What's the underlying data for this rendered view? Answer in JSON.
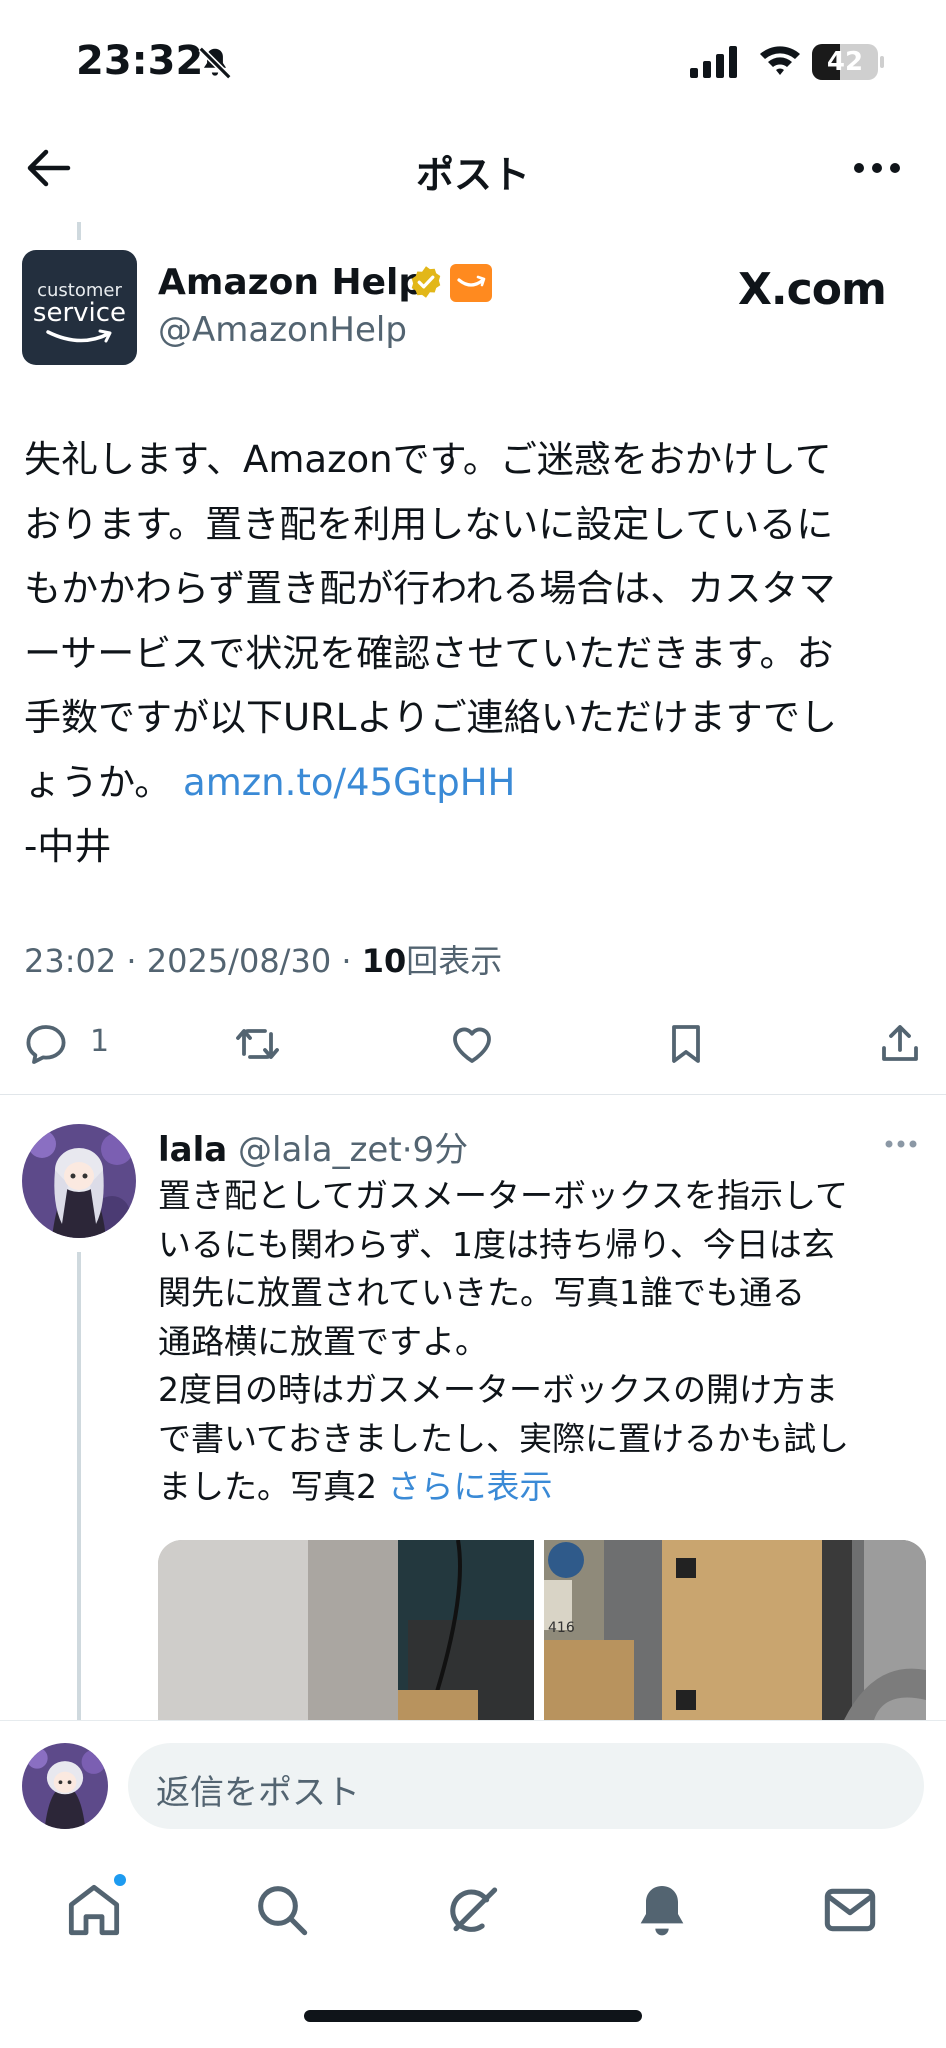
{
  "status_bar": {
    "time": "23:32",
    "battery_level": "42",
    "battery_fraction": 0.42,
    "icons": [
      "bell-slash-icon",
      "cellular-signal-icon",
      "wifi-icon",
      "battery-icon"
    ]
  },
  "header": {
    "title": "ポスト",
    "back_icon": "arrow-left-icon",
    "more_icon": "more-horizontal-icon"
  },
  "tweet": {
    "avatar": {
      "line1": "customer",
      "line2": "service"
    },
    "display_name": "Amazon Help",
    "handle": "@AmazonHelp",
    "watermark": "X.com",
    "body_lines": [
      "失礼します、Amazonです。ご迷惑をおかけして",
      "おります。置き配を利用しないに設定しているに",
      "もかかわらず置き配が行われる場合は、カスタマ",
      "ーサービスで状況を確認させていただきます。お",
      "手数ですが以下URLよりご連絡いただけますでし"
    ],
    "body_last_prefix": "ょうか。 ",
    "link": "amzn.to/45GtpHH",
    "signature": "-中井",
    "time": "23:02",
    "date": "2025/08/30",
    "views_count": "10",
    "views_label": "回表示",
    "reply_count": "1",
    "accent": "#3a8ad6"
  },
  "reply": {
    "name": "lala",
    "handle": "@lala_zet",
    "time": "9分",
    "lines": [
      "置き配としてガスメーターボックスを指示して",
      "いるにも関わらず、1度は持ち帰り、今日は玄",
      "関先に放置されていきた。写真1誰でも通る",
      "通路横に放置ですよ。",
      "2度目の時はガスメーターボックスの開け方ま",
      "で書いておきましたし、実際に置けるかも試し"
    ],
    "last_line_prefix": "ました。写真2 ",
    "show_more": "さらに表示",
    "photo2_label": "416"
  },
  "compose": {
    "placeholder": "返信をポスト"
  },
  "tabbar": {
    "items": [
      "home-icon",
      "search-icon",
      "grok-icon",
      "notifications-icon",
      "messages-icon"
    ]
  }
}
